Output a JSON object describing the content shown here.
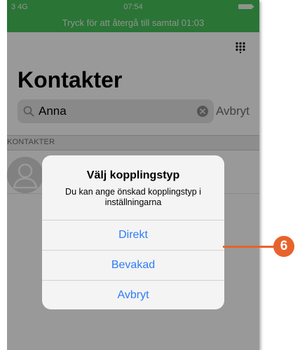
{
  "status_bar": {
    "carrier": "3  4G",
    "time": "07:54",
    "call_banner": "Tryck för att återgå till samtal 01:03"
  },
  "page": {
    "title": "Kontakter"
  },
  "search": {
    "value": "Anna",
    "cancel_label": "Avbryt"
  },
  "section": {
    "label": "KONTAKTER"
  },
  "dialog": {
    "title": "Välj kopplingstyp",
    "message": "Du kan ange önskad kopplingstyp i inställningarna",
    "buttons": [
      {
        "label": "Direkt"
      },
      {
        "label": "Bevakad"
      },
      {
        "label": "Avbryt"
      }
    ]
  },
  "callout": {
    "number": "6"
  },
  "colors": {
    "call_bar": "#46c25a",
    "accent": "#2f7cf6",
    "callout": "#e8632b"
  },
  "icons": [
    "signal-icon",
    "battery-icon",
    "keypad-icon",
    "search-icon",
    "clear-icon",
    "avatar-placeholder-icon"
  ]
}
